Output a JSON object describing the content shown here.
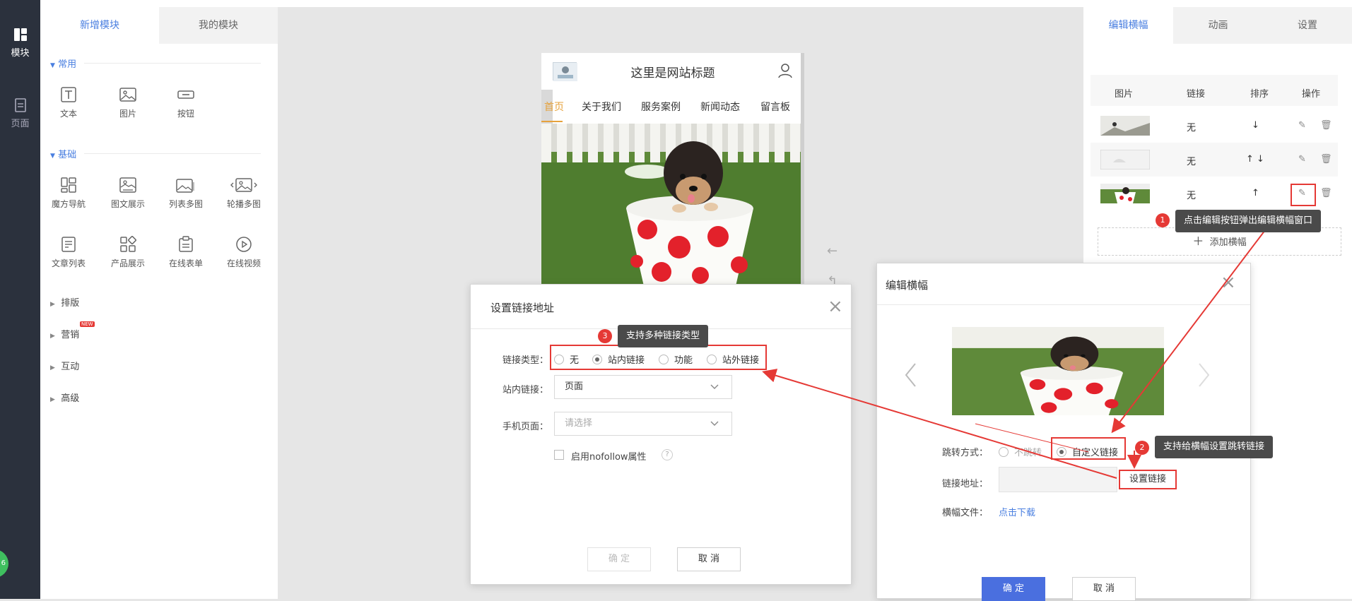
{
  "sidebar": {
    "items": [
      {
        "label": "模块",
        "icon": "modules-icon"
      },
      {
        "label": "页面",
        "icon": "page-icon"
      }
    ]
  },
  "left_panel": {
    "tabs": [
      {
        "label": "新增模块"
      },
      {
        "label": "我的模块"
      }
    ],
    "section_common": "常用",
    "common_tools": [
      {
        "label": "文本"
      },
      {
        "label": "图片"
      },
      {
        "label": "按钮"
      }
    ],
    "section_basic": "基础",
    "basic_tools": [
      {
        "label": "魔方导航"
      },
      {
        "label": "图文展示"
      },
      {
        "label": "列表多图"
      },
      {
        "label": "轮播多图"
      },
      {
        "label": "文章列表"
      },
      {
        "label": "产品展示"
      },
      {
        "label": "在线表单"
      },
      {
        "label": "在线视频"
      }
    ],
    "groups": [
      {
        "label": "排版"
      },
      {
        "label": "营销"
      },
      {
        "label": "互动"
      },
      {
        "label": "高级"
      }
    ],
    "new_badge": "NEW",
    "float_badge": "6"
  },
  "preview": {
    "site_title": "这里是网站标题",
    "nav": [
      "首页",
      "关于我们",
      "服务案例",
      "新闻动态",
      "留言板"
    ]
  },
  "right_panel": {
    "tabs": [
      {
        "label": "编辑横幅"
      },
      {
        "label": "动画"
      },
      {
        "label": "设置"
      }
    ],
    "table_headers": [
      "图片",
      "链接",
      "排序",
      "操作"
    ],
    "rows": [
      {
        "link": "无",
        "sort": "↓"
      },
      {
        "link": "无",
        "sort": "↑ ↓"
      },
      {
        "link": "无",
        "sort": "↑"
      }
    ],
    "add_banner": "添加横幅"
  },
  "link_dialog": {
    "title": "设置链接地址",
    "link_type_label": "链接类型：",
    "link_types": [
      {
        "label": "无",
        "selected": false
      },
      {
        "label": "站内链接",
        "selected": true
      },
      {
        "label": "功能",
        "selected": false
      },
      {
        "label": "站外链接",
        "selected": false
      }
    ],
    "internal_link_label": "站内链接：",
    "internal_link_value": "页面",
    "mobile_page_label": "手机页面：",
    "mobile_page_placeholder": "请选择",
    "nofollow_label": "启用nofollow属性",
    "help_glyph": "?",
    "confirm": "确 定",
    "cancel": "取 消"
  },
  "banner_dialog": {
    "title": "编辑横幅",
    "jump_label": "跳转方式：",
    "jump_options": [
      {
        "label": "不跳转",
        "selected": false
      },
      {
        "label": "自定义链接",
        "selected": true
      }
    ],
    "link_addr_label": "链接地址：",
    "set_link": "设置链接",
    "file_label": "横幅文件：",
    "download": "点击下载",
    "confirm": "确 定",
    "cancel": "取 消"
  },
  "annotations": [
    {
      "num": "1",
      "text": "点击编辑按钮弹出编辑横幅窗口"
    },
    {
      "num": "2",
      "text": "支持给横幅设置跳转链接"
    },
    {
      "num": "3",
      "text": "支持多种链接类型"
    }
  ],
  "colors": {
    "accent": "#4a7fe0",
    "annotation": "#e53935",
    "sidebar": "#2b313d",
    "primary_button": "#4a6fdf"
  }
}
